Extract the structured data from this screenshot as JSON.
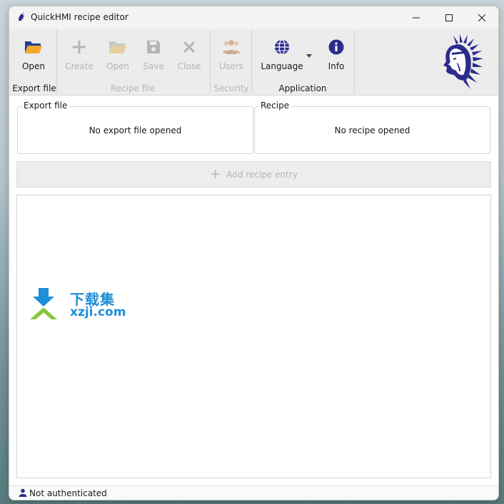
{
  "window": {
    "title": "QuickHMI recipe editor"
  },
  "ribbon": {
    "export_file": {
      "open_label": "Open",
      "group_label": "Export file"
    },
    "recipe_file": {
      "create_label": "Create",
      "open_label": "Open",
      "save_label": "Save",
      "close_label": "Close",
      "group_label": "Recipe file"
    },
    "security": {
      "users_label": "Users",
      "group_label": "Security"
    },
    "application": {
      "language_label": "Language",
      "info_label": "Info",
      "group_label": "Application"
    }
  },
  "panels": {
    "export_file": {
      "legend": "Export file",
      "status": "No export file opened"
    },
    "recipe": {
      "legend": "Recipe",
      "status": "No recipe opened"
    }
  },
  "add_entry": {
    "label": "Add recipe entry"
  },
  "watermark": {
    "line1": "下载集",
    "line2": "xzji.com"
  },
  "status_bar": {
    "text": "Not authenticated"
  },
  "colors": {
    "accent_blue": "#2c2c8c",
    "folder_orange": "#f0a830",
    "disabled_grey": "#b5b5b5",
    "watermark_blue": "#1f8fd8",
    "watermark_green": "#8bc53f"
  }
}
